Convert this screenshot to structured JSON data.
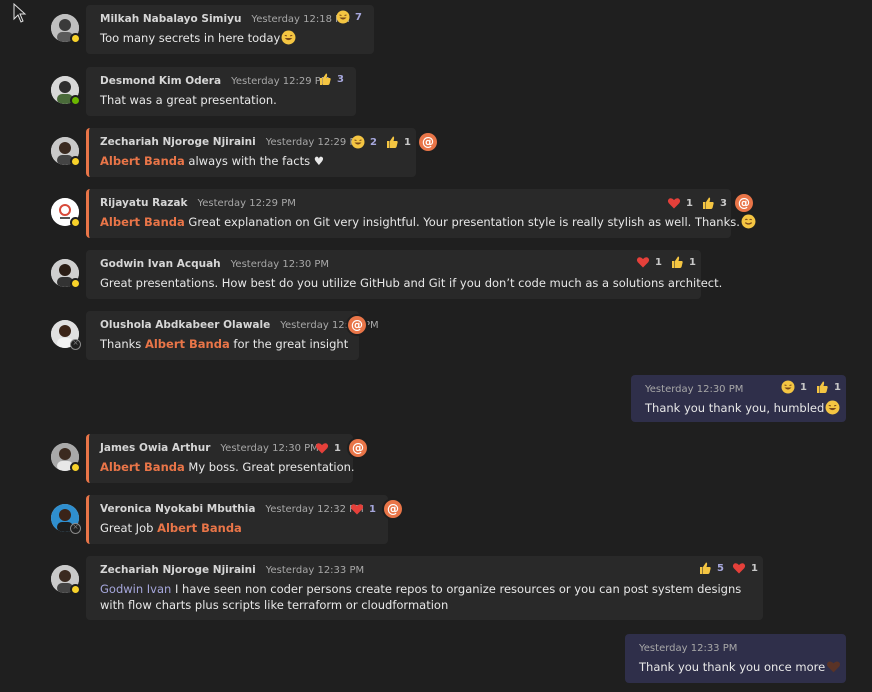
{
  "messages": [
    {
      "author": "Milkah Nabalayo Simiyu",
      "time": "Yesterday 12:18 PM",
      "text": "Too many secrets in here today",
      "reactions": [
        {
          "icon": "laugh-emoji",
          "count": "7"
        }
      ]
    },
    {
      "author": "Desmond Kim Odera",
      "time": "Yesterday 12:29 PM",
      "text": "That was a great presentation.",
      "reactions": [
        {
          "icon": "thumbs-up-emoji",
          "count": "3"
        }
      ]
    },
    {
      "author": "Zechariah Njoroge Njiraini",
      "time": "Yesterday 12:29 PM",
      "mention": "Albert Banda",
      "text": " always with the facts ♥",
      "reactions": [
        {
          "icon": "laugh-emoji",
          "count": "2"
        },
        {
          "icon": "thumbs-up-emoji",
          "count": "1"
        }
      ]
    },
    {
      "author": "Rijayatu Razak",
      "time": "Yesterday 12:29 PM",
      "mention": "Albert Banda",
      "text": " Great explanation on Git very insightful. Your presentation style is really stylish as well. Thanks.",
      "reactions": [
        {
          "icon": "heart-emoji",
          "count": "1"
        },
        {
          "icon": "thumbs-up-emoji",
          "count": "3"
        }
      ]
    },
    {
      "author": "Godwin Ivan Acquah",
      "time": "Yesterday 12:30 PM",
      "text": "Great presentations. How best do you utilize GitHub and Git if you don’t code  much as a solutions architect.",
      "reactions": [
        {
          "icon": "heart-emoji",
          "count": "1"
        },
        {
          "icon": "thumbs-up-emoji",
          "count": "1"
        }
      ]
    },
    {
      "author": "Olushola Abdkabeer Olawale",
      "time": "Yesterday 12:30 PM",
      "text_before": "Thanks ",
      "mention": "Albert Banda",
      "text": " for the great insight"
    },
    {
      "time": "Yesterday 12:30 PM",
      "text": "Thank you thank you, humbled",
      "reactions": [
        {
          "icon": "laugh-emoji",
          "count": "1"
        },
        {
          "icon": "thumbs-up-emoji",
          "count": "1"
        }
      ]
    },
    {
      "author": "James Owia Arthur",
      "time": "Yesterday 12:30 PM",
      "mention": "Albert Banda",
      "text": " My boss. Great presentation.",
      "reactions": [
        {
          "icon": "heart-emoji",
          "count": "1"
        }
      ]
    },
    {
      "author": "Veronica Nyokabi Mbuthia",
      "time": "Yesterday 12:32 PM",
      "text_before": "Great Job ",
      "mention": "Albert Banda",
      "reactions": [
        {
          "icon": "heart-emoji",
          "count": "1"
        }
      ]
    },
    {
      "author": "Zechariah Njoroge Njiraini",
      "time": "Yesterday 12:33 PM",
      "mention": "Godwin Ivan",
      "text": " I have seen non coder persons create repos to organize resources or you can post system designs with flow charts plus scripts like terraform or cloudformation",
      "reactions": [
        {
          "icon": "thumbs-up-emoji",
          "count": "5"
        },
        {
          "icon": "heart-emoji",
          "count": "1"
        }
      ]
    },
    {
      "time": "Yesterday 12:33 PM",
      "text": "Thank you thank you once more"
    }
  ],
  "mention_icon_symbol": "@"
}
